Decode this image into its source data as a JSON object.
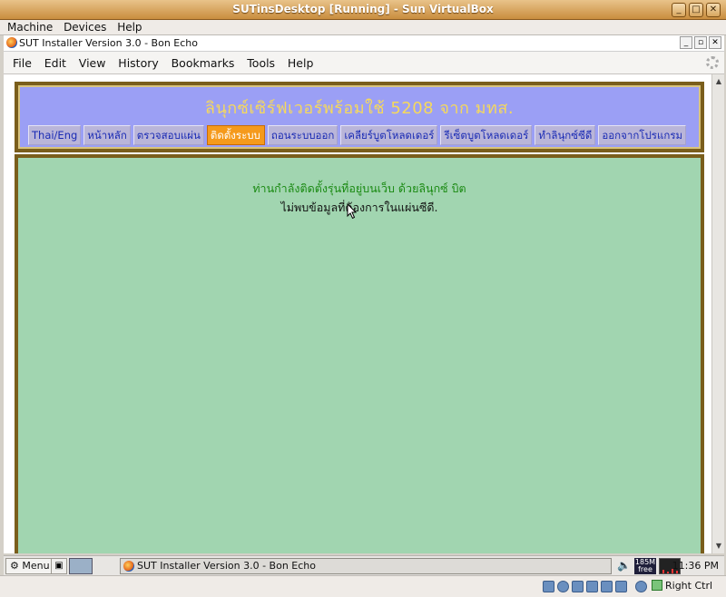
{
  "vbox": {
    "title": "SUTinsDesktop [Running] - Sun VirtualBox",
    "menu": [
      "Machine",
      "Devices",
      "Help"
    ],
    "host_key": "Right Ctrl"
  },
  "browser": {
    "title": "SUT Installer Version 3.0 - Bon Echo",
    "menu": [
      "File",
      "Edit",
      "View",
      "History",
      "Bookmarks",
      "Tools",
      "Help"
    ]
  },
  "page": {
    "site_title": "ลินุกซ์เซิร์ฟเวอร์พร้อมใช้ 5208 จาก มทส.",
    "nav": [
      {
        "label": "Thai/Eng",
        "active": false
      },
      {
        "label": "หน้าหลัก",
        "active": false
      },
      {
        "label": "ตรวจสอบแผ่น",
        "active": false
      },
      {
        "label": "ติดตั้งระบบ",
        "active": true
      },
      {
        "label": "ถอนระบบออก",
        "active": false
      },
      {
        "label": "เคลียร์บูตโหลดเดอร์",
        "active": false
      },
      {
        "label": "รีเซ็ตบูตโหลดเดอร์",
        "active": false
      },
      {
        "label": "ทำลินุกซ์ซีดี",
        "active": false
      },
      {
        "label": "ออกจากโปรแกรม",
        "active": false
      }
    ],
    "message_green": "ท่านกำลังติดตั้งรุ่นที่อยู่บนเว็บ ด้วยลินุกซ์ บิต",
    "message_black": "ไม่พบข้อมูลที่ต้องการในแผ่นซีดี."
  },
  "taskbar": {
    "menu_label": "Menu",
    "task_label": "SUT Installer Version 3.0 - Bon Echo",
    "mem_top": "185M",
    "mem_bottom": "free",
    "clock": "11:36 PM"
  },
  "colors": {
    "header_bg": "#9b9ff5",
    "title_color": "#f6d95b",
    "nav_active": "#f59a1c",
    "content_bg": "#a1d5b0",
    "frame": "#7a5e1c"
  }
}
